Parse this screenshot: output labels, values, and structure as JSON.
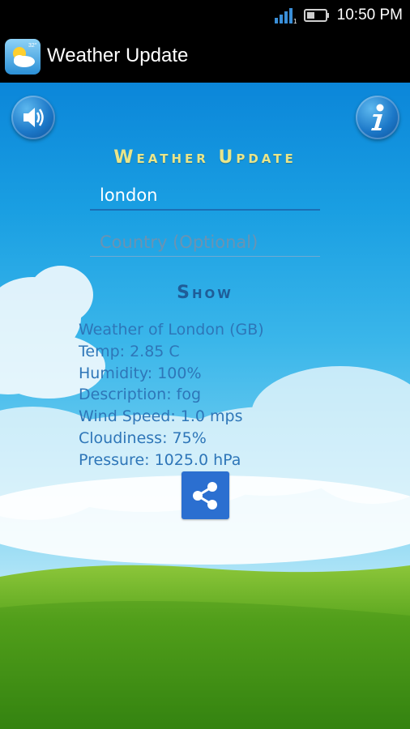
{
  "status_bar": {
    "time": "10:50 PM",
    "icons": [
      "signal-icon",
      "battery-icon"
    ]
  },
  "action_bar": {
    "title": "Weather Update",
    "icon": "weather-app-icon"
  },
  "main": {
    "heading": "Weather Update",
    "city_input": {
      "value": "london",
      "placeholder": ""
    },
    "country_input": {
      "value": "",
      "placeholder": "Country (Optional)"
    },
    "show_label": "Show",
    "weather_lines": [
      "Weather of London (GB)",
      "Temp: 2.85 C",
      "Humidity: 100%",
      "Description: fog",
      "Wind Speed: 1.0 mps",
      "Cloudiness: 75%",
      "Pressure: 1025.0 hPa"
    ],
    "buttons": {
      "sound_icon": "speaker-icon",
      "info_icon": "info-icon",
      "share_icon": "share-icon"
    }
  },
  "colors": {
    "sky_top": "#0b86d9",
    "heading": "#e9e58a",
    "info_text": "#2e76b8",
    "share_button": "#2b6fd0",
    "grass": "#5aa61e"
  }
}
